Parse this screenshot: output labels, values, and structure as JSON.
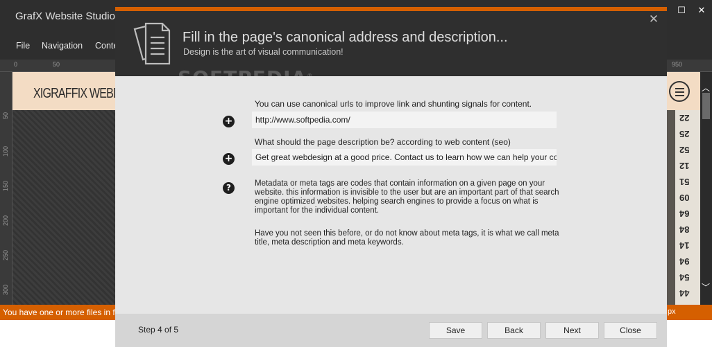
{
  "app": {
    "title": "GrafX Website Studio",
    "window_controls": {
      "minimize": "—",
      "maximize": "☐",
      "close": "✕"
    }
  },
  "menu": [
    "File",
    "Navigation",
    "Conte"
  ],
  "ruler": {
    "top_ticks": [
      "0",
      "50",
      "950"
    ],
    "left_ticks": [
      "50",
      "100",
      "150",
      "200",
      "250",
      "300"
    ]
  },
  "site": {
    "logo": "XIGRAFFIX WEBD",
    "tape_numbers": [
      "22",
      "25",
      "52",
      "12",
      "51",
      "09",
      "64",
      "84",
      "14",
      "94",
      "54",
      "44"
    ]
  },
  "statusbar": {
    "text": "You have one or more files in f",
    "unit": "px"
  },
  "watermark": {
    "text": "SOFTPEDIA",
    "mark": "®"
  },
  "dialog": {
    "title": "Fill in the page's canonical address and description...",
    "subtitle": "Design is the art of visual communication!",
    "close": "✕",
    "canonical_label": "You can use canonical urls to improve link and shunting signals for content.",
    "canonical_value": "http://www.softpedia.com/",
    "description_label": "What should the page description be? according to web content (seo)",
    "description_value": "Get great webdesign at a good price. Contact us to learn how we can help your company",
    "help_para_1": "Metadata or meta tags are codes that contain information on a given page on your website. this information is invisible to the user but are an important part of that search engine optimized websites. helping search engines to provide a focus on what is important for the individual content.",
    "help_para_2": "Have you not seen this before, or do not know about meta tags, it is what we call meta title, meta description and meta keywords.",
    "step": "Step 4 of 5",
    "buttons": {
      "save": "Save",
      "back": "Back",
      "next": "Next",
      "close": "Close"
    },
    "icons": {
      "add": "+",
      "help": "?"
    }
  },
  "colors": {
    "accent": "#d55f00",
    "dialog_body": "#e6e6e6",
    "dialog_header": "#2f2f2f"
  }
}
